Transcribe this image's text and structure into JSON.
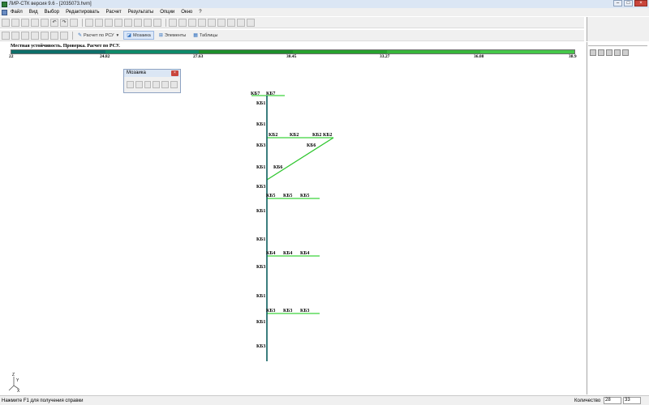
{
  "window": {
    "title": "ЛИР-СТК версия 9.6 - [2035073.hvm]"
  },
  "menu": [
    "Файл",
    "Вид",
    "Выбор",
    "Редактировать",
    "Расчет",
    "Результаты",
    "Опции",
    "Окно",
    "?"
  ],
  "toolbar2": {
    "rsu_label": "Расчет по РСУ",
    "mosaic_label": "Мозаика",
    "elements_label": "Элементы",
    "tables_label": "Таблицы"
  },
  "legend": {
    "title": "Местная устойчивость. Проверка. Расчет по РСУ.",
    "ticks": [
      "22",
      "24.82",
      "27.63",
      "30.45",
      "33.27",
      "36.08",
      "38.9"
    ],
    "colors": [
      "#0e6f6a",
      "#0f8a6a",
      "#1e8f2c",
      "#27a22f",
      "#37b63b",
      "#45c84a"
    ]
  },
  "mosaic_window": {
    "title": "Мозаика"
  },
  "model": {
    "column_labels": [
      "КБ1",
      "КБ1",
      "КБ3",
      "КБ1",
      "КБ3",
      "КБ1",
      "КБ1",
      "КБ3",
      "КБ1",
      "КБ1",
      "КБ3"
    ],
    "beam_labels": {
      "kb7": [
        "КБ7",
        "КБ7"
      ],
      "kb2": [
        "КБ2",
        "КБ2",
        "КБ2",
        "КБ2"
      ],
      "kb6": [
        "КБ6",
        "КБ6"
      ],
      "kb5": [
        "КБ5",
        "КБ5",
        "КБ5"
      ],
      "kb4": [
        "КБ4",
        "КБ4",
        "КБ4"
      ],
      "kb3": [
        "КБ3",
        "КБ3",
        "КБ3"
      ]
    },
    "colors": {
      "column": "#0b5e5e",
      "beam": "#3cd43c",
      "brace": "#2ec62e"
    }
  },
  "axes": {
    "z": "Z",
    "y": "Y",
    "x": "X"
  },
  "status": {
    "help": "Нажмите F1 для получения справки",
    "count_label": "Количество",
    "count_a": "28",
    "count_b": "33"
  }
}
